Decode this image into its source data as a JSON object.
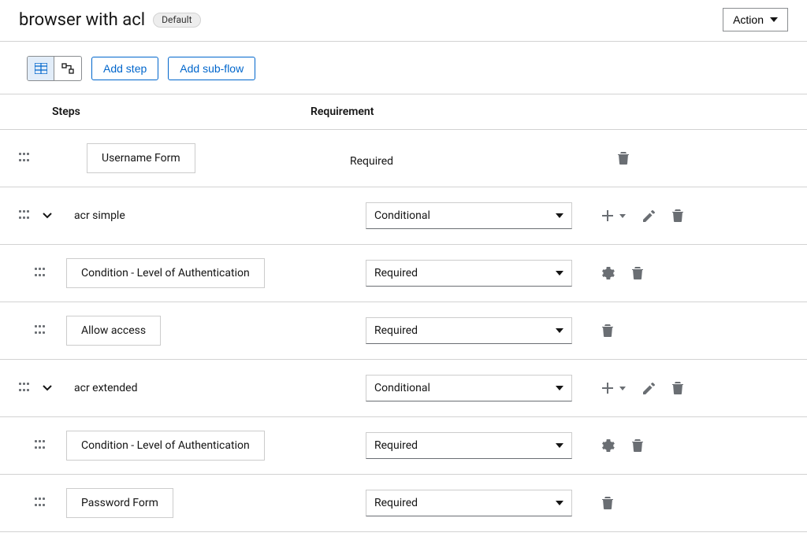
{
  "header": {
    "title": "browser with acl",
    "badge": "Default",
    "action_label": "Action"
  },
  "toolbar": {
    "add_step": "Add step",
    "add_subflow": "Add sub-flow"
  },
  "columns": {
    "steps": "Steps",
    "requirement": "Requirement"
  },
  "rows": [
    {
      "id": "username",
      "indent": 0,
      "kind": "box",
      "label": "Username Form",
      "requirement_type": "static",
      "requirement": "Required",
      "actions": [
        "trash"
      ]
    },
    {
      "id": "acr-simple",
      "indent": 0,
      "kind": "subflow",
      "label": "acr simple",
      "requirement_type": "select",
      "requirement": "Conditional",
      "actions": [
        "plus",
        "menu",
        "pencil",
        "trash"
      ]
    },
    {
      "id": "acr-simple-cond",
      "indent": 1,
      "kind": "box",
      "label": "Condition - Level of Authentication",
      "requirement_type": "select",
      "requirement": "Required",
      "actions": [
        "gear",
        "trash"
      ]
    },
    {
      "id": "acr-simple-allow",
      "indent": 1,
      "kind": "box",
      "label": "Allow access",
      "requirement_type": "select",
      "requirement": "Required",
      "actions": [
        "trash"
      ]
    },
    {
      "id": "acr-extended",
      "indent": 0,
      "kind": "subflow",
      "label": "acr extended",
      "requirement_type": "select",
      "requirement": "Conditional",
      "actions": [
        "plus",
        "menu",
        "pencil",
        "trash"
      ]
    },
    {
      "id": "acr-extended-cond",
      "indent": 1,
      "kind": "box",
      "label": "Condition - Level of Authentication",
      "requirement_type": "select",
      "requirement": "Required",
      "actions": [
        "gear",
        "trash"
      ]
    },
    {
      "id": "acr-extended-pass",
      "indent": 1,
      "kind": "box",
      "label": "Password Form",
      "requirement_type": "select",
      "requirement": "Required",
      "actions": [
        "trash"
      ]
    }
  ]
}
